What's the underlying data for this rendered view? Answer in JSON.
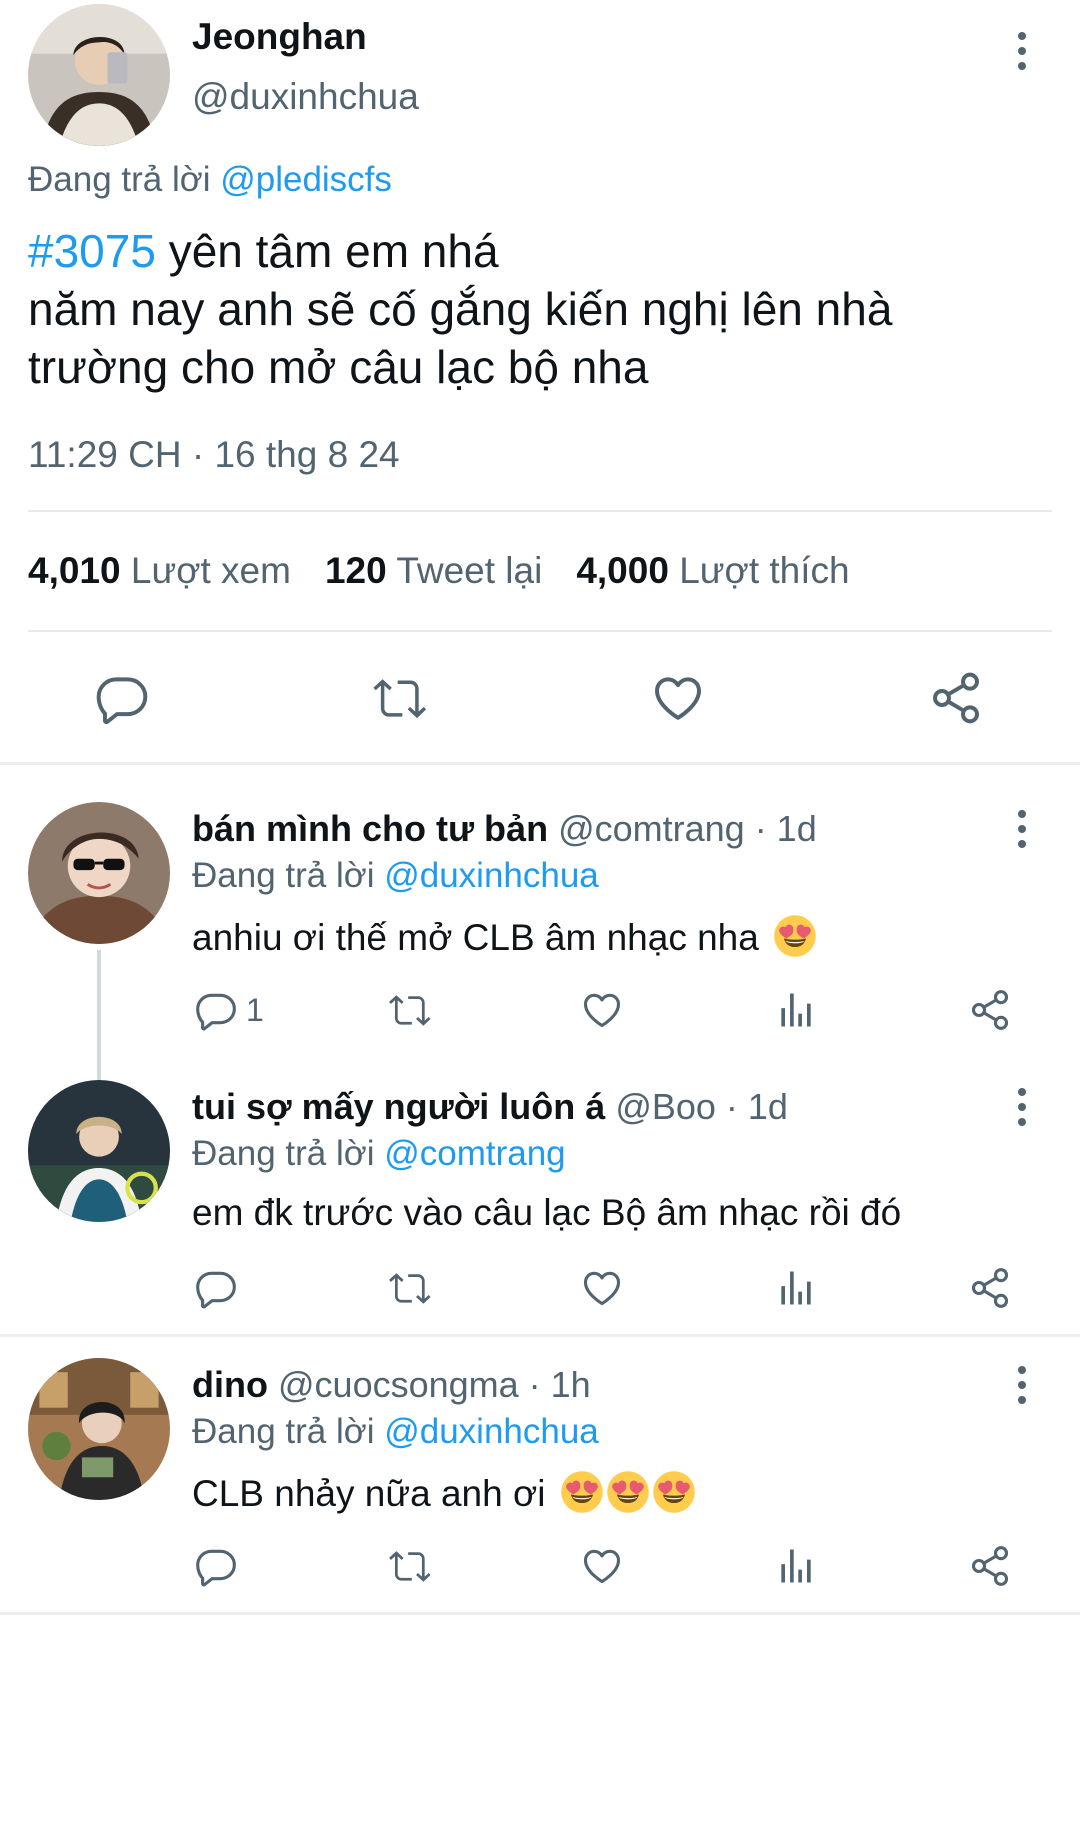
{
  "tweet": {
    "author_name": "Jeonghan",
    "author_handle": "@duxinhchua",
    "reply_prefix": "Đang trả lời",
    "reply_to": "@plediscfs",
    "hashtag": "#3075",
    "line1_rest": " yên tâm em nhá",
    "line2": "năm nay anh sẽ cố gắng kiến nghị lên nhà",
    "line3": "trường cho mở  câu lạc bộ nha",
    "timestamp": "11:29 CH · 16 thg 8 24",
    "stats": {
      "views_count": "4,010",
      "views_label": "Lượt xem",
      "retweets_count": "120",
      "retweets_label": "Tweet lại",
      "likes_count": "4,000",
      "likes_label": "Lượt thích"
    }
  },
  "replies": [
    {
      "name": "bán mình cho tư bản",
      "handle": "@comtrang",
      "time": " · 1d",
      "reply_prefix": "Đang trả lời",
      "reply_to": "@duxinhchua",
      "text": "anhiu ơi thế mở CLB âm nhạc nha",
      "emoji_count": 1,
      "reply_count": "1"
    },
    {
      "name": "tui sợ mấy người luôn á",
      "handle": "@Boo",
      "time": " · 1d",
      "reply_prefix": "Đang trả lời",
      "reply_to": "@comtrang",
      "text": "em đk trước vào câu lạc Bộ âm nhạc  rồi đó",
      "emoji_count": 0,
      "reply_count": ""
    },
    {
      "name": "dino",
      "handle": "@cuocsongma",
      "time": " · 1h",
      "reply_prefix": "Đang trả lời",
      "reply_to": "@duxinhchua",
      "text": "CLB nhảy nữa anh ơi",
      "emoji_count": 3,
      "reply_count": ""
    }
  ],
  "colors": {
    "link": "#1d9bf0",
    "secondary_text": "#536471",
    "primary_text": "#0f1419",
    "divider": "#e7e9ea"
  },
  "icons": {
    "more": "more-vertical-icon",
    "reply": "reply-icon",
    "retweet": "retweet-icon",
    "like": "heart-icon",
    "views": "analytics-icon",
    "share": "share-icon",
    "emoji": "heart-eyes-emoji"
  }
}
